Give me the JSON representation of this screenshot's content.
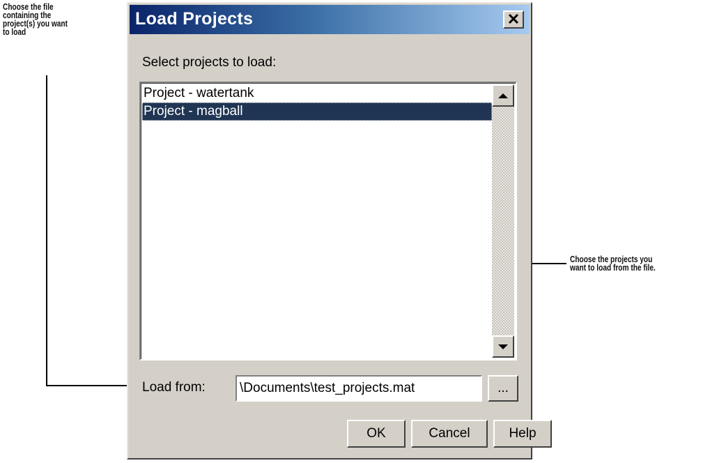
{
  "annotations": {
    "left_callout": [
      "Choose the file",
      "containing the",
      "project(s) you want",
      "to load"
    ],
    "right_callout": [
      "Choose the projects you",
      "want to load from the file."
    ]
  },
  "dialog": {
    "title": "Load Projects",
    "close_glyph": "✕",
    "prompt": "Select projects to load:",
    "projects": [
      {
        "label": "Project - watertank",
        "selected": false
      },
      {
        "label": "Project - magball",
        "selected": true
      }
    ],
    "load_from_label": "Load from:",
    "load_from_value": "\\Documents\\test_projects.mat",
    "browse_label": "...",
    "ok_label": "OK",
    "cancel_label": "Cancel",
    "help_label": "Help"
  },
  "colors": {
    "dialog_face": "#d4d0c8",
    "title_gradient_start": "#0a246a",
    "title_gradient_end": "#a6caf0",
    "selection": "#1f3553"
  },
  "icons": {
    "close": "close-icon",
    "scroll_up": "scroll-up-arrow-icon",
    "scroll_down": "scroll-down-arrow-icon"
  }
}
